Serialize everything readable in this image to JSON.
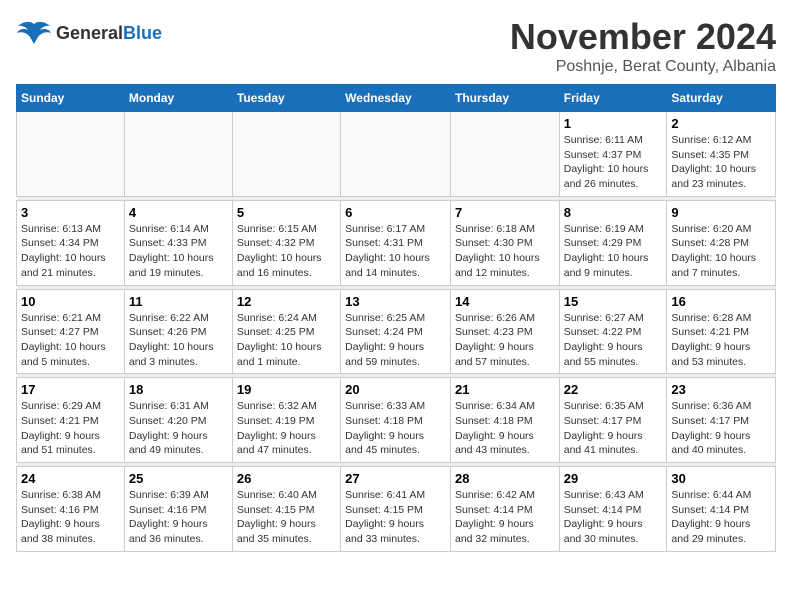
{
  "header": {
    "logo_general": "General",
    "logo_blue": "Blue",
    "month_title": "November 2024",
    "location": "Poshnje, Berat County, Albania"
  },
  "weekdays": [
    "Sunday",
    "Monday",
    "Tuesday",
    "Wednesday",
    "Thursday",
    "Friday",
    "Saturday"
  ],
  "weeks": [
    [
      {
        "day": "",
        "info": ""
      },
      {
        "day": "",
        "info": ""
      },
      {
        "day": "",
        "info": ""
      },
      {
        "day": "",
        "info": ""
      },
      {
        "day": "",
        "info": ""
      },
      {
        "day": "1",
        "info": "Sunrise: 6:11 AM\nSunset: 4:37 PM\nDaylight: 10 hours\nand 26 minutes."
      },
      {
        "day": "2",
        "info": "Sunrise: 6:12 AM\nSunset: 4:35 PM\nDaylight: 10 hours\nand 23 minutes."
      }
    ],
    [
      {
        "day": "3",
        "info": "Sunrise: 6:13 AM\nSunset: 4:34 PM\nDaylight: 10 hours\nand 21 minutes."
      },
      {
        "day": "4",
        "info": "Sunrise: 6:14 AM\nSunset: 4:33 PM\nDaylight: 10 hours\nand 19 minutes."
      },
      {
        "day": "5",
        "info": "Sunrise: 6:15 AM\nSunset: 4:32 PM\nDaylight: 10 hours\nand 16 minutes."
      },
      {
        "day": "6",
        "info": "Sunrise: 6:17 AM\nSunset: 4:31 PM\nDaylight: 10 hours\nand 14 minutes."
      },
      {
        "day": "7",
        "info": "Sunrise: 6:18 AM\nSunset: 4:30 PM\nDaylight: 10 hours\nand 12 minutes."
      },
      {
        "day": "8",
        "info": "Sunrise: 6:19 AM\nSunset: 4:29 PM\nDaylight: 10 hours\nand 9 minutes."
      },
      {
        "day": "9",
        "info": "Sunrise: 6:20 AM\nSunset: 4:28 PM\nDaylight: 10 hours\nand 7 minutes."
      }
    ],
    [
      {
        "day": "10",
        "info": "Sunrise: 6:21 AM\nSunset: 4:27 PM\nDaylight: 10 hours\nand 5 minutes."
      },
      {
        "day": "11",
        "info": "Sunrise: 6:22 AM\nSunset: 4:26 PM\nDaylight: 10 hours\nand 3 minutes."
      },
      {
        "day": "12",
        "info": "Sunrise: 6:24 AM\nSunset: 4:25 PM\nDaylight: 10 hours\nand 1 minute."
      },
      {
        "day": "13",
        "info": "Sunrise: 6:25 AM\nSunset: 4:24 PM\nDaylight: 9 hours\nand 59 minutes."
      },
      {
        "day": "14",
        "info": "Sunrise: 6:26 AM\nSunset: 4:23 PM\nDaylight: 9 hours\nand 57 minutes."
      },
      {
        "day": "15",
        "info": "Sunrise: 6:27 AM\nSunset: 4:22 PM\nDaylight: 9 hours\nand 55 minutes."
      },
      {
        "day": "16",
        "info": "Sunrise: 6:28 AM\nSunset: 4:21 PM\nDaylight: 9 hours\nand 53 minutes."
      }
    ],
    [
      {
        "day": "17",
        "info": "Sunrise: 6:29 AM\nSunset: 4:21 PM\nDaylight: 9 hours\nand 51 minutes."
      },
      {
        "day": "18",
        "info": "Sunrise: 6:31 AM\nSunset: 4:20 PM\nDaylight: 9 hours\nand 49 minutes."
      },
      {
        "day": "19",
        "info": "Sunrise: 6:32 AM\nSunset: 4:19 PM\nDaylight: 9 hours\nand 47 minutes."
      },
      {
        "day": "20",
        "info": "Sunrise: 6:33 AM\nSunset: 4:18 PM\nDaylight: 9 hours\nand 45 minutes."
      },
      {
        "day": "21",
        "info": "Sunrise: 6:34 AM\nSunset: 4:18 PM\nDaylight: 9 hours\nand 43 minutes."
      },
      {
        "day": "22",
        "info": "Sunrise: 6:35 AM\nSunset: 4:17 PM\nDaylight: 9 hours\nand 41 minutes."
      },
      {
        "day": "23",
        "info": "Sunrise: 6:36 AM\nSunset: 4:17 PM\nDaylight: 9 hours\nand 40 minutes."
      }
    ],
    [
      {
        "day": "24",
        "info": "Sunrise: 6:38 AM\nSunset: 4:16 PM\nDaylight: 9 hours\nand 38 minutes."
      },
      {
        "day": "25",
        "info": "Sunrise: 6:39 AM\nSunset: 4:16 PM\nDaylight: 9 hours\nand 36 minutes."
      },
      {
        "day": "26",
        "info": "Sunrise: 6:40 AM\nSunset: 4:15 PM\nDaylight: 9 hours\nand 35 minutes."
      },
      {
        "day": "27",
        "info": "Sunrise: 6:41 AM\nSunset: 4:15 PM\nDaylight: 9 hours\nand 33 minutes."
      },
      {
        "day": "28",
        "info": "Sunrise: 6:42 AM\nSunset: 4:14 PM\nDaylight: 9 hours\nand 32 minutes."
      },
      {
        "day": "29",
        "info": "Sunrise: 6:43 AM\nSunset: 4:14 PM\nDaylight: 9 hours\nand 30 minutes."
      },
      {
        "day": "30",
        "info": "Sunrise: 6:44 AM\nSunset: 4:14 PM\nDaylight: 9 hours\nand 29 minutes."
      }
    ]
  ]
}
